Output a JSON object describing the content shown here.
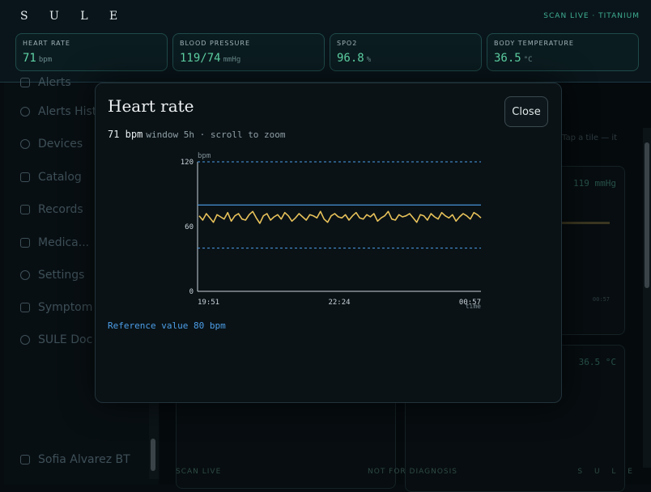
{
  "brand": "S U L E",
  "status": "SCAN LIVE · TITANIUM",
  "vitals": [
    {
      "label": "HEART RATE",
      "value": "71",
      "unit": "bpm"
    },
    {
      "label": "BLOOD PRESSURE",
      "value": "119/74",
      "unit": "mmHg"
    },
    {
      "label": "SPO2",
      "value": "96.8",
      "unit": "%"
    },
    {
      "label": "BODY TEMPERATURE",
      "value": "36.5",
      "unit": "°C"
    }
  ],
  "sidebar": {
    "items": [
      {
        "label": "Alerts",
        "icon": "bell-icon"
      },
      {
        "label": "Alerts Hist",
        "icon": "history-icon"
      },
      {
        "label": "Devices",
        "icon": "watch-icon"
      },
      {
        "label": "Catalog",
        "icon": "book-icon"
      },
      {
        "label": "Records",
        "icon": "file-icon"
      },
      {
        "label": "Medica...",
        "icon": "chat-icon"
      },
      {
        "label": "Settings",
        "icon": "gear-icon"
      },
      {
        "label": "Symptom J",
        "icon": "edit-icon"
      },
      {
        "label": "SULE Doc",
        "icon": "stethoscope-icon"
      }
    ],
    "user": "Sofia Alvarez BT"
  },
  "background": {
    "hint": "Tap a tile — it",
    "card1_value": "119 mmHg",
    "card1_time": "00:57",
    "card2_value": "36.5 °C",
    "footer_left": "SCAN LIVE",
    "footer_mid": "NOT FOR DIAGNOSIS",
    "footer_right": "S U L E"
  },
  "modal": {
    "title": "Heart rate",
    "close_label": "Close",
    "current_value": "71 bpm",
    "subtitle": "window 5h · scroll to zoom",
    "reference_text": "Reference value 80 bpm"
  },
  "chart_data": {
    "type": "line",
    "ylabel": "bpm",
    "xlabel": "time",
    "ylim": [
      0,
      120
    ],
    "yticks": [
      0,
      60,
      120
    ],
    "xticks": [
      "19:51",
      "22:24",
      "00:57"
    ],
    "reference_lines": {
      "upper_limit": 120,
      "reference": 80,
      "lower_limit": 40
    },
    "colors": {
      "series": "#e8c25a",
      "reference": "#4c9ee8",
      "axis": "#c8d3d8"
    },
    "series": [
      {
        "values": [
          70,
          66,
          72,
          68,
          64,
          71,
          69,
          67,
          73,
          65,
          70,
          72,
          67,
          66,
          71,
          74,
          68,
          63,
          70,
          72,
          66,
          69,
          71,
          67,
          73,
          70,
          65,
          68,
          72,
          69,
          66,
          71,
          70,
          68,
          74,
          67,
          64,
          70,
          72,
          69,
          68,
          71,
          66,
          70,
          73,
          68,
          67,
          71,
          69,
          72,
          65,
          68,
          70,
          74,
          67,
          66,
          71,
          69,
          70,
          72,
          68,
          64,
          71,
          70,
          66,
          72,
          69,
          67,
          73,
          70,
          68,
          71,
          65,
          69,
          72,
          70,
          67,
          73,
          71,
          68
        ]
      }
    ]
  }
}
